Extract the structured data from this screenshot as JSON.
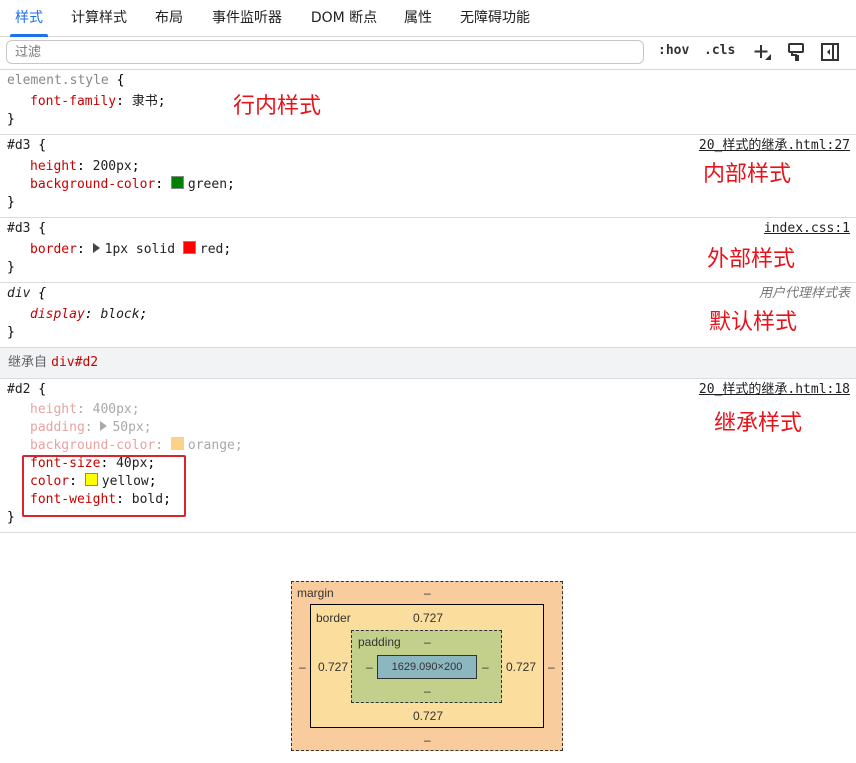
{
  "tabs": [
    {
      "label": "样式",
      "active": true
    },
    {
      "label": "计算样式",
      "active": false
    },
    {
      "label": "布局",
      "active": false
    },
    {
      "label": "事件监听器",
      "active": false
    },
    {
      "label": "DOM 断点",
      "active": false
    },
    {
      "label": "属性",
      "active": false
    },
    {
      "label": "无障碍功能",
      "active": false
    }
  ],
  "toolbar": {
    "filter_placeholder": "过滤",
    "hov_label": ":hov",
    "cls_label": ".cls"
  },
  "rules": {
    "inline": {
      "selector": "element.style",
      "open": " {",
      "close": "}",
      "props": [
        {
          "name": "font-family",
          "value": "隶书"
        }
      ],
      "annotation": "行内样式"
    },
    "internal": {
      "selector": "#d3",
      "open": " {",
      "close": "}",
      "source": "20_样式的继承.html:27",
      "props": [
        {
          "name": "height",
          "value": "200px"
        },
        {
          "name": "background-color",
          "value": "green",
          "swatch": "#008000"
        }
      ],
      "annotation": "内部样式"
    },
    "external": {
      "selector": "#d3",
      "open": " {",
      "close": "}",
      "source": "index.css:1",
      "props": [
        {
          "name": "border",
          "value_a": "1px solid",
          "value_b": "red",
          "swatch": "#ff0000"
        }
      ],
      "annotation": "外部样式"
    },
    "user_agent": {
      "selector": "div",
      "open": " {",
      "close": "}",
      "source": "用户代理样式表",
      "props": [
        {
          "name": "display",
          "value": "block"
        }
      ],
      "annotation": "默认样式"
    },
    "inherited_header": {
      "prefix": "继承自",
      "element": "div#d2"
    },
    "inherited": {
      "selector": "#d2",
      "open": " {",
      "close": "}",
      "source": "20_样式的继承.html:18",
      "faded_props": [
        {
          "name": "height",
          "value": "400px"
        },
        {
          "name": "padding",
          "value": "50px"
        },
        {
          "name": "background-color",
          "value": "orange",
          "swatch": "#ffa500"
        }
      ],
      "props": [
        {
          "name": "font-size",
          "value": "40px"
        },
        {
          "name": "color",
          "value": "yellow",
          "swatch": "#ffff00"
        },
        {
          "name": "font-weight",
          "value": "bold"
        }
      ],
      "annotation": "继承样式"
    }
  },
  "box_model": {
    "margin_label": "margin",
    "margin_top": "–",
    "margin_bottom": "–",
    "margin_left": "–",
    "margin_right": "–",
    "border_label": "border",
    "border_top": "0.727",
    "border_bottom": "0.727",
    "border_left": "0.727",
    "border_right": "0.727",
    "padding_label": "padding",
    "padding_top": "–",
    "padding_bottom": "–",
    "padding_left": "–",
    "padding_right": "–",
    "content": "1629.090×200"
  },
  "colors": {
    "accent": "#1a73e8",
    "property": "#c80000",
    "annotation": "#e8131a"
  },
  "icons": [
    "new-style-rule-icon",
    "paint-brush-icon",
    "toggle-sidebar-icon"
  ]
}
